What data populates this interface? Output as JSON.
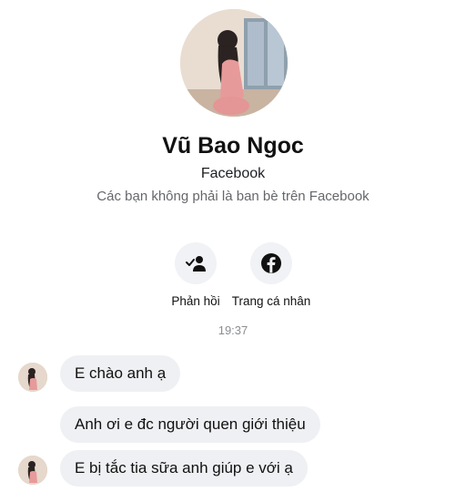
{
  "profile": {
    "name": "Vũ Bao Ngoc",
    "platform": "Facebook",
    "relationship_note": "Các bạn không phải là ban bè trên Facebook"
  },
  "actions": [
    {
      "label": "Phản hồi",
      "icon": "person-check-icon"
    },
    {
      "label": "Trang cá nhân",
      "icon": "facebook-icon"
    }
  ],
  "timestamp": "19:37",
  "messages": [
    {
      "text": "E chào anh ạ"
    },
    {
      "text": "Anh ơi e đc người quen giới thiệu"
    },
    {
      "text": "E bị tắc tia sữa anh giúp e với ạ"
    }
  ],
  "colors": {
    "bubble_bg": "#eff0f3",
    "action_bg": "#f0f2f5",
    "secondary_text": "#65676b"
  }
}
